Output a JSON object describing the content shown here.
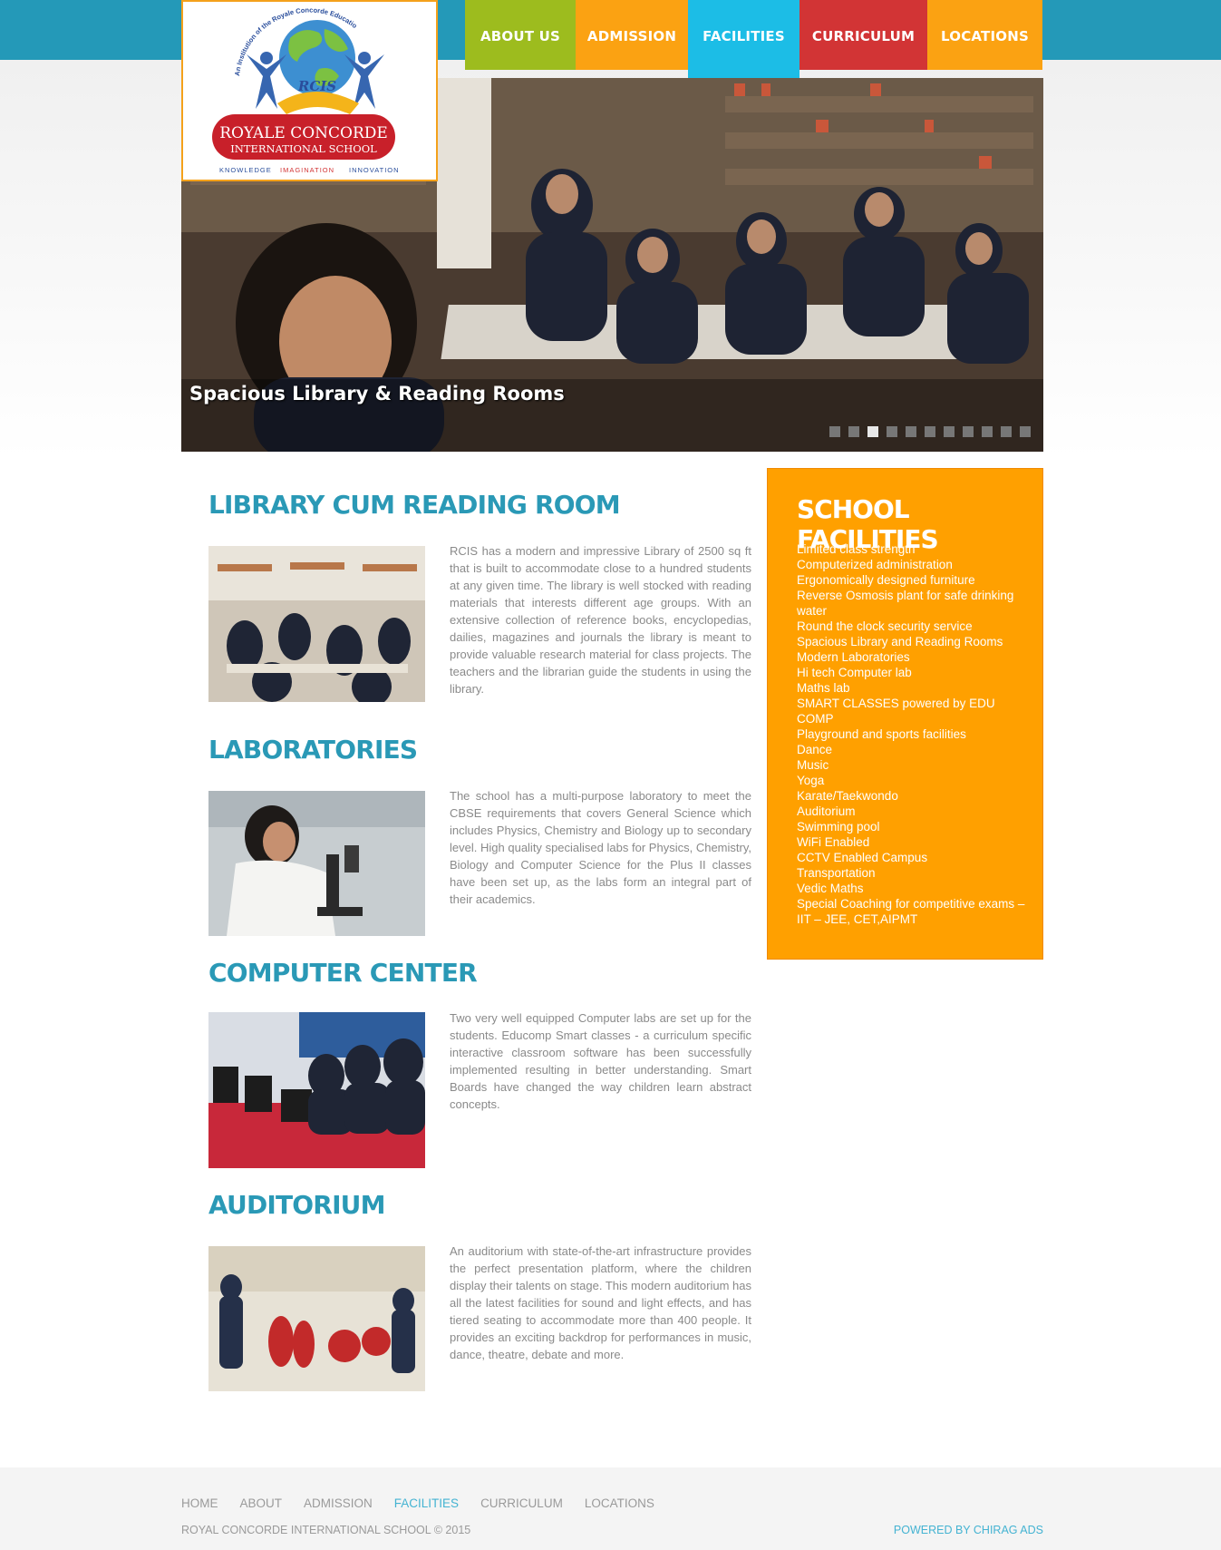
{
  "logo": {
    "title": "ROYALE CONCORDE",
    "subtitle": "INTERNATIONAL SCHOOL",
    "arc_text": "An Institution of the Royale Concorde Educational Trust",
    "monogram": "RCIS",
    "tagline_1": "KNOWLEDGE",
    "tagline_2": "IMAGINATION",
    "tagline_3": "INNOVATION"
  },
  "nav": {
    "items": [
      {
        "label": "ABOUT US",
        "color": "#9dbc1e"
      },
      {
        "label": "ADMISSION",
        "color": "#fba212"
      },
      {
        "label": "FACILITIES",
        "color": "#1cbde6"
      },
      {
        "label": "CURRICULUM",
        "color": "#d23435"
      },
      {
        "label": "LOCATIONS",
        "color": "#fba212"
      }
    ],
    "active": "FACILITIES"
  },
  "slider": {
    "caption": "Spacious Library & Reading Rooms",
    "slide_count": 11,
    "active_slide": 3
  },
  "sections": [
    {
      "title": "LIBRARY CUM READING ROOM",
      "text": "RCIS has a modern and impressive Library of 2500 sq ft that is built to accommodate close to a hundred students at any given time. The library is well stocked with reading materials that interests different age groups. With an extensive collection of reference books, encyclopedias, dailies, magazines and journals the library is meant to provide valuable research material for class projects. The teachers and the librarian guide the students in using the library."
    },
    {
      "title": "LABORATORIES",
      "text": "The school has a multi-purpose laboratory to meet the CBSE requirements that covers General Science which includes Physics, Chemistry and Biology up to secondary level. High quality specialised labs for Physics, Chemistry, Biology and Computer Science for the Plus II classes have been set up, as the labs form an integral part of their academics."
    },
    {
      "title": "COMPUTER CENTER",
      "text": "Two very well equipped Computer labs are set up for the students. Educomp Smart classes - a curriculum specific interactive classroom software has been successfully implemented resulting in better understanding. Smart Boards have changed the way children learn abstract concepts."
    },
    {
      "title": "AUDITORIUM",
      "text": "An auditorium with state-of-the-art infrastructure provides the perfect presentation platform, where the children display their talents on stage. This modern auditorium has all the latest facilities for sound and light effects, and has tiered seating to accommodate more than 400 people. It provides an exciting backdrop for performances in music, dance, theatre, debate and more."
    }
  ],
  "sidebar": {
    "title": "SCHOOL FACILITIES",
    "items": [
      "Limited class strength",
      "Computerized administration",
      "Ergonomically designed furniture",
      "Reverse Osmosis plant for safe drinking water",
      "Round the clock security service",
      "Spacious Library and Reading Rooms",
      "Modern Laboratories",
      "Hi tech Computer lab",
      "Maths lab",
      "SMART CLASSES powered by EDU COMP",
      "Playground and sports facilities",
      "Dance",
      "Music",
      "Yoga",
      "Karate/Taekwondo",
      "Auditorium",
      "Swimming pool",
      "WiFi Enabled",
      "CCTV Enabled Campus",
      "Transportation",
      "Vedic Maths",
      "Special Coaching for competitive exams – IIT – JEE, CET,AIPMT"
    ]
  },
  "footer": {
    "links": [
      "HOME",
      "ABOUT",
      "ADMISSION",
      "FACILITIES",
      "CURRICULUM",
      "LOCATIONS"
    ],
    "active": "FACILITIES",
    "copyright": "ROYAL CONCORDE INTERNATIONAL SCHOOL © 2015",
    "powered": "POWERED BY CHIRAG ADS"
  },
  "colors": {
    "topbar": "#2499b8",
    "heading": "#2a99b6",
    "sidebar": "#ffa000",
    "footer_link_active": "#44b3d2"
  }
}
